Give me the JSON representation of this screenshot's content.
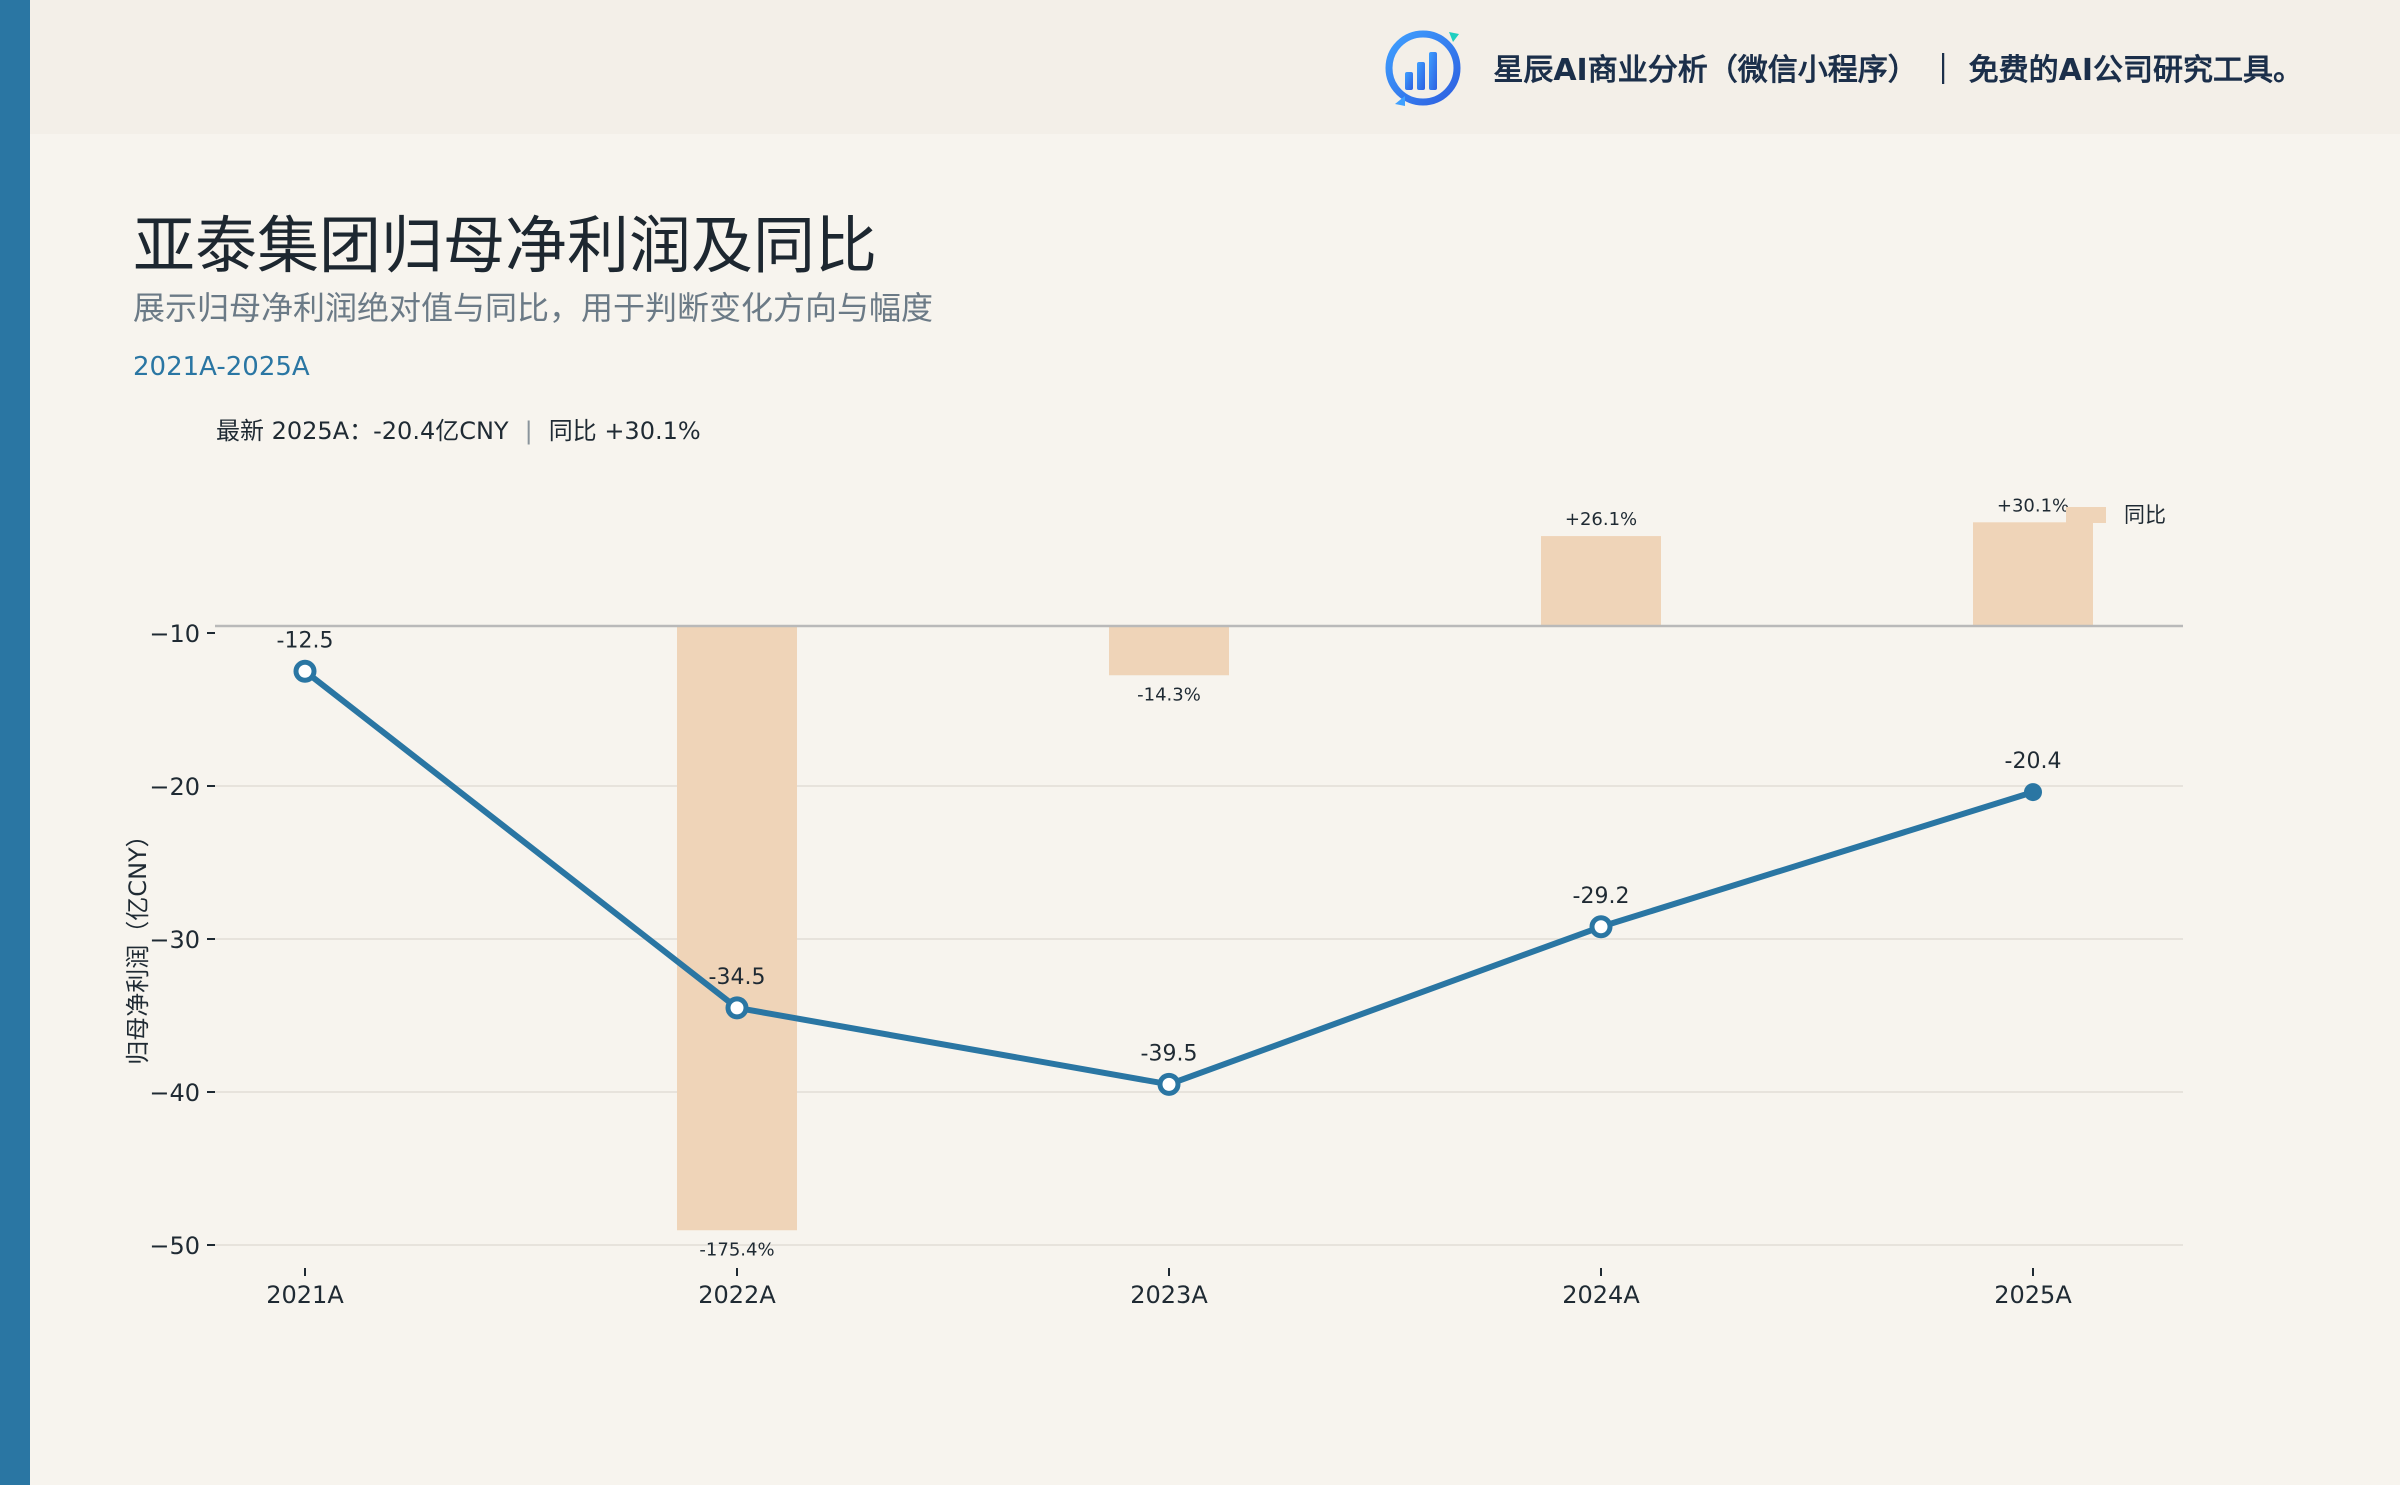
{
  "header": {
    "brand_text": "星辰AI商业分析（微信小程序） ｜ 免费的AI公司研究工具。",
    "logo_icon": "bar-chart-logo-icon"
  },
  "title": "亚泰集团归母净利润及同比",
  "subtitle": "展示归母净利润绝对值与同比，用于判断变化方向与幅度",
  "range": "2021A-2025A",
  "latest": {
    "label": "最新 2025A：-20.4亿CNY",
    "sep": "|",
    "yoy": "同比 +30.1%"
  },
  "colors": {
    "accent": "#2a76a3",
    "bar": "#efd4b8",
    "background": "#f7f4ee"
  },
  "chart_data": {
    "type": "line",
    "categories": [
      "2021A",
      "2022A",
      "2023A",
      "2024A",
      "2025A"
    ],
    "ylabel": "归母净利润（亿CNY）",
    "ylim": [
      -50,
      -10
    ],
    "yticks": [
      -10,
      -20,
      -30,
      -40,
      -50
    ],
    "ytick_labels": [
      "−10",
      "−20",
      "−30",
      "−40",
      "−50"
    ],
    "series": [
      {
        "values": [
          -12.5,
          -34.5,
          -39.5,
          -29.2,
          -20.4
        ],
        "value_labels": [
          "-12.5",
          "-34.5",
          "-39.5",
          "-29.2",
          "-20.4"
        ]
      },
      {
        "name": "同比",
        "type": "bar",
        "categories": [
          "2022A",
          "2023A",
          "2024A",
          "2025A"
        ],
        "values": [
          -175.4,
          -14.3,
          26.1,
          30.1
        ],
        "value_labels": [
          "-175.4%",
          "-14.3%",
          "+26.1%",
          "+30.1%"
        ]
      }
    ],
    "legend": [
      "同比"
    ],
    "legend_position": "top-right",
    "grid": true
  }
}
